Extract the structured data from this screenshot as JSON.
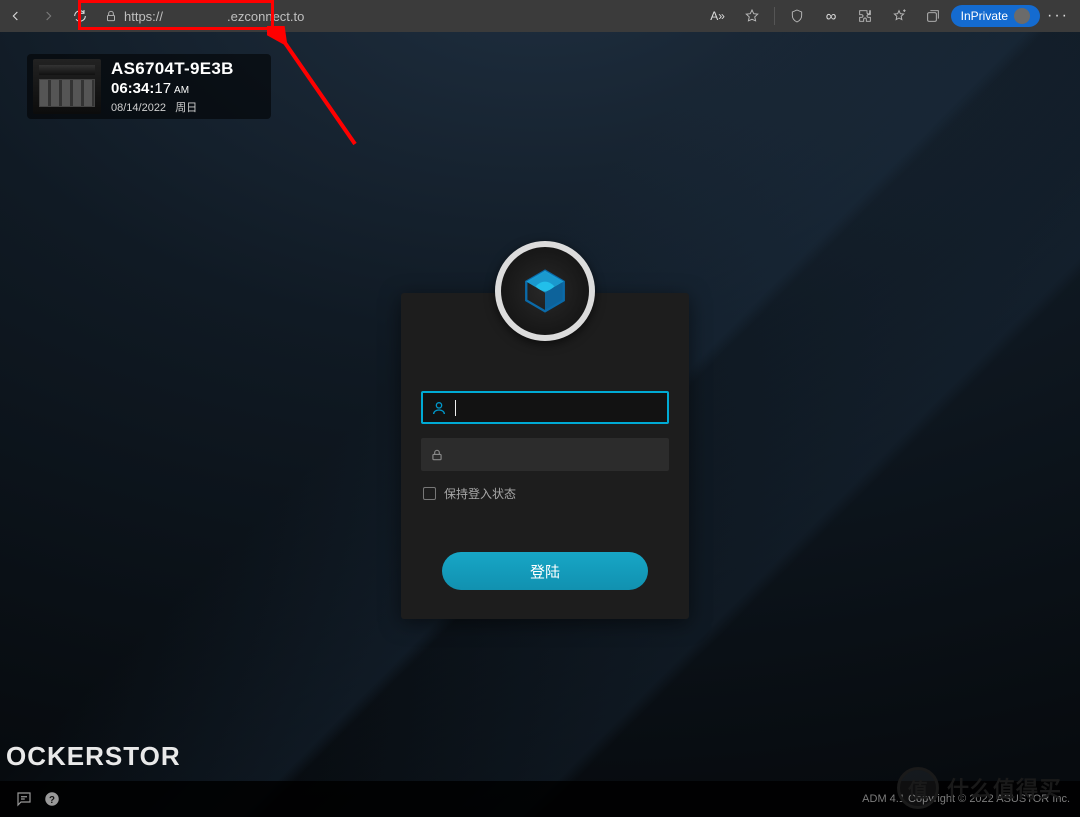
{
  "browser": {
    "url_prefix": "https://",
    "url_suffix": ".ezconnect.to",
    "read_aloud": "A»",
    "inprivate": "InPrivate",
    "more": "···"
  },
  "nas": {
    "name": "AS6704T-9E3B",
    "time_hm": "06:34:",
    "time_s": "17",
    "ampm": "AM",
    "date": "08/14/2022",
    "weekday": "周日"
  },
  "login": {
    "username_value": "",
    "password_value": "",
    "remember": "保持登入状态",
    "submit": "登陆"
  },
  "footer": {
    "brand": "OCKERSTOR",
    "copyright": "ADM 4.1  Copyright © 2022 ASUSTOR Inc."
  },
  "watermark": {
    "icon": "值",
    "text": "什么值得买"
  }
}
